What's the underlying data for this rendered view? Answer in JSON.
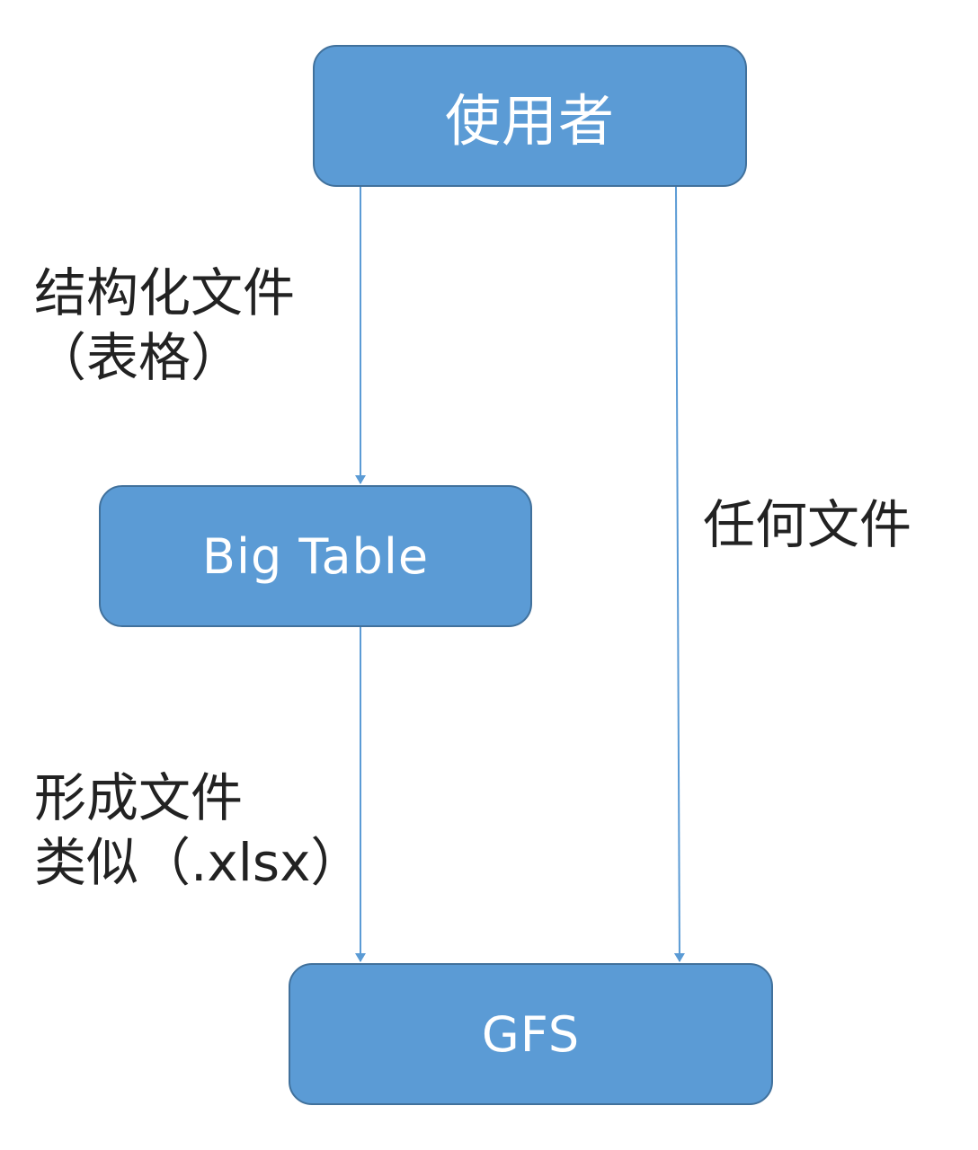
{
  "diagram": {
    "nodes": {
      "user": "使用者",
      "bigtable": "Big Table",
      "gfs": "GFS"
    },
    "edges": {
      "structured_line1": "结构化文件",
      "structured_line2": "（表格）",
      "any_files": "任何文件",
      "form_line1": "形成文件",
      "form_line2": "类似（.xlsx）"
    },
    "colors": {
      "node_fill": "#5b9bd5",
      "node_border": "#41719c",
      "arrow": "#5b9bd5",
      "text": "#222222"
    }
  }
}
